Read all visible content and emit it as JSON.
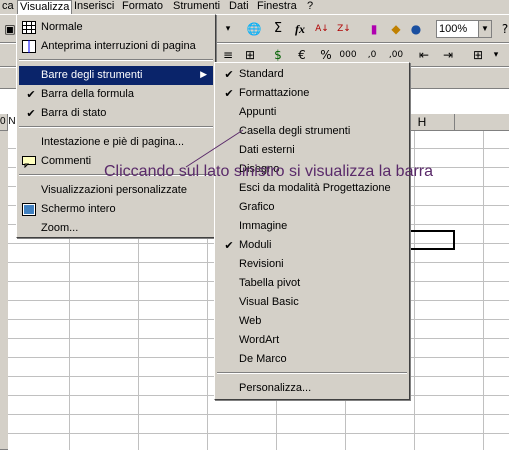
{
  "menubar": {
    "items": [
      "ca",
      "Visualizza",
      "Inserisci",
      "Formato",
      "Strumenti",
      "Dati",
      "Finestra",
      "?"
    ]
  },
  "toolbar": {
    "zoom": "100%",
    "sigma": "Σ",
    "fx": "fx",
    "euro": "€",
    "percent": "%",
    "thousands": "000"
  },
  "sheet": {
    "col_h": "H",
    "row_marker": "0 N"
  },
  "view_menu": {
    "items": [
      {
        "label": "Normale"
      },
      {
        "label": "Anteprima interruzioni di pagina"
      },
      {
        "label": "Barre degli strumenti"
      },
      {
        "label": "Barra della formula"
      },
      {
        "label": "Barra di stato"
      },
      {
        "label": "Intestazione e piè di pagina..."
      },
      {
        "label": "Commenti"
      },
      {
        "label": "Visualizzazioni personalizzate"
      },
      {
        "label": "Schermo intero"
      },
      {
        "label": "Zoom..."
      }
    ]
  },
  "toolbars_menu": {
    "items": [
      {
        "label": "Standard",
        "checked": true
      },
      {
        "label": "Formattazione",
        "checked": true
      },
      {
        "label": "Appunti",
        "checked": false
      },
      {
        "label": "Casella degli strumenti",
        "checked": false
      },
      {
        "label": "Dati esterni",
        "checked": false
      },
      {
        "label": "Disegno",
        "checked": false
      },
      {
        "label": "Esci da modalità Progettazione",
        "checked": false
      },
      {
        "label": "Grafico",
        "checked": false
      },
      {
        "label": "Immagine",
        "checked": false
      },
      {
        "label": "Moduli",
        "checked": true
      },
      {
        "label": "Revisioni",
        "checked": false
      },
      {
        "label": "Tabella pivot",
        "checked": false
      },
      {
        "label": "Visual Basic",
        "checked": false
      },
      {
        "label": "Web",
        "checked": false
      },
      {
        "label": "WordArt",
        "checked": false
      },
      {
        "label": "De Marco",
        "checked": false
      },
      {
        "label": "Personalizza...",
        "checked": false
      }
    ]
  },
  "annotation": "Cliccando sul lato sinistro si visualizza la barra",
  "colors": {
    "highlight": "#0a246a",
    "annotation": "#5a2a6a",
    "face": "#d4d0c8"
  }
}
